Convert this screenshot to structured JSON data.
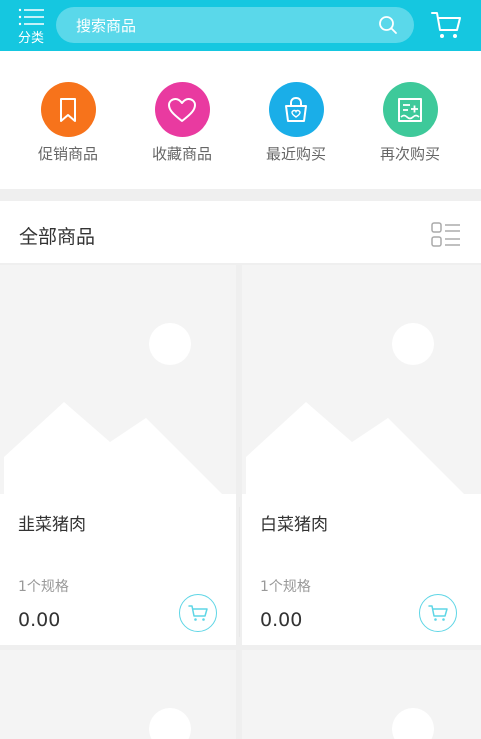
{
  "header": {
    "menu_label": "分类",
    "search_placeholder": "搜索商品"
  },
  "quick_links": [
    {
      "label": "促销商品",
      "icon": "bookmark-icon",
      "color": "#f7731b"
    },
    {
      "label": "收藏商品",
      "icon": "heart-icon",
      "color": "#e93aa0"
    },
    {
      "label": "最近购买",
      "icon": "shopping-bag-icon",
      "color": "#1aaee8"
    },
    {
      "label": "再次购买",
      "icon": "receipt-icon",
      "color": "#3ec99a"
    }
  ],
  "section": {
    "title": "全部商品"
  },
  "products": [
    {
      "name": "韭菜猪肉",
      "spec": "1个规格",
      "price": "0.00"
    },
    {
      "name": "白菜猪肉",
      "spec": "1个规格",
      "price": "0.00"
    }
  ],
  "colors": {
    "accent": "#15c7e0",
    "cart_outline": "#5fd6e6"
  }
}
